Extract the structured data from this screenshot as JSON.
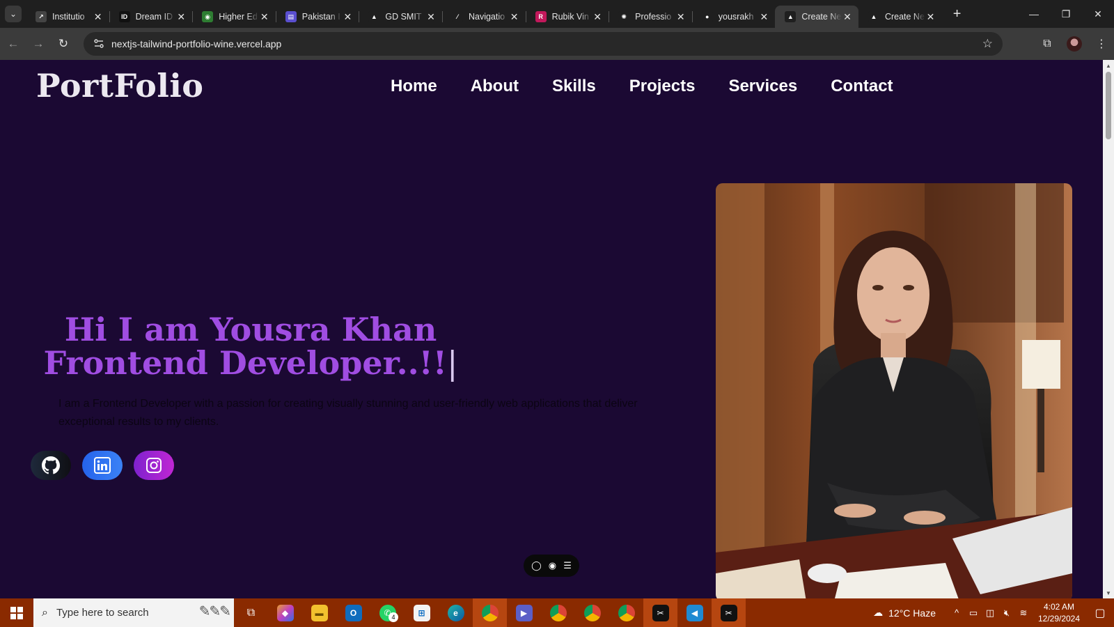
{
  "browser": {
    "tabs": [
      {
        "title": "Institutio",
        "favicon": "institution-icon"
      },
      {
        "title": "Dream ID",
        "favicon": "dream-id-icon"
      },
      {
        "title": "Higher Ed",
        "favicon": "higher-ed-icon"
      },
      {
        "title": "Pakistan I",
        "favicon": "pakistan-icon"
      },
      {
        "title": "GD SMIT",
        "favicon": "google-drive-icon"
      },
      {
        "title": "Navigatio",
        "favicon": "navigation-icon"
      },
      {
        "title": "Rubik Vin",
        "favicon": "rubik-icon"
      },
      {
        "title": "Professio",
        "favicon": "openai-icon"
      },
      {
        "title": "yousrakh",
        "favicon": "github-icon"
      },
      {
        "title": "Create Ne",
        "favicon": "vercel-icon",
        "active": true
      },
      {
        "title": "Create Ne",
        "favicon": "vercel-icon"
      }
    ],
    "url": "nextjs-tailwind-portfolio-wine.vercel.app"
  },
  "site": {
    "logo": "PortFolio",
    "nav": [
      "Home",
      "About",
      "Skills",
      "Projects",
      "Services",
      "Contact"
    ],
    "hero": {
      "line1": "Hi I am Yousra Khan",
      "line2": "Frontend Developer..!!",
      "cursor": "|",
      "description": "I am a Frontend Developer with a passion for creating visually stunning and user-friendly web applications that deliver exceptional results to my clients."
    },
    "socials": [
      "github-icon",
      "linkedin-icon",
      "instagram-icon"
    ],
    "colors": {
      "background": "#1b0933",
      "accent": "#a04de2"
    }
  },
  "taskbar": {
    "search_placeholder": "Type here to search",
    "whatsapp_badge": "4",
    "weather": "12°C  Haze",
    "time": "4:02 AM",
    "date": "12/29/2024"
  }
}
